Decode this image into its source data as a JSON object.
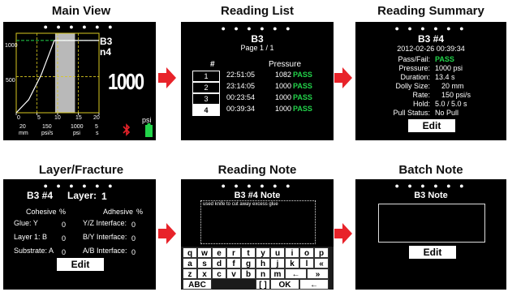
{
  "titles": {
    "main_view": "Main View",
    "reading_list": "Reading List",
    "reading_summary": "Reading Summary",
    "layer_fracture": "Layer/Fracture",
    "reading_note": "Reading Note",
    "batch_note": "Batch Note"
  },
  "dots": "● ● ● ● ● ●",
  "main_view": {
    "y_ticks": [
      "1000",
      "500"
    ],
    "x_ticks": [
      "0",
      "5",
      "10",
      "15",
      "20"
    ],
    "x_unit": "psi",
    "batch": "B3",
    "reading": "n4",
    "big_value": "1000",
    "bottom_values": [
      "20",
      "150",
      "1000",
      "5"
    ],
    "bottom_units": [
      "mm",
      "psi/s",
      "psi",
      "s"
    ],
    "curve_points": [
      [
        0,
        0
      ],
      [
        3,
        180
      ],
      [
        6,
        520
      ],
      [
        8,
        820
      ],
      [
        9.2,
        1000
      ],
      [
        20,
        1000
      ]
    ],
    "x_range": [
      0,
      20
    ],
    "y_range": [
      0,
      1100
    ]
  },
  "reading_list": {
    "batch": "B3",
    "page": "Page 1 / 1",
    "col_num": "#",
    "col_pressure": "Pressure",
    "rows": [
      {
        "num": "1",
        "time": "22:51:05",
        "pressure": "1082",
        "status": "PASS"
      },
      {
        "num": "2",
        "time": "23:14:05",
        "pressure": "1000",
        "status": "PASS"
      },
      {
        "num": "3",
        "time": "00:23:54",
        "pressure": "1000",
        "status": "PASS"
      },
      {
        "num": "4",
        "time": "00:39:34",
        "pressure": "1000",
        "status": "PASS"
      }
    ]
  },
  "reading_summary": {
    "title": "B3 #4",
    "datetime": "2012-02-26 00:39:34",
    "rows": [
      {
        "label": "Pass/Fail:",
        "value": "PASS"
      },
      {
        "label": "Pressure:",
        "value": "1000 psi"
      },
      {
        "label": "Duration:",
        "value": "13.4 s"
      },
      {
        "label": "Dolly Size:",
        "value": "20 mm"
      },
      {
        "label": "Rate:",
        "value": "150 psi/s"
      },
      {
        "label": "Hold:",
        "value": "5.0 / 5.0 s"
      },
      {
        "label": "Pull Status:",
        "value": "No Pull"
      }
    ],
    "edit": "Edit"
  },
  "layer_fracture": {
    "title": "B3 #4",
    "layer_label": "Layer:",
    "layer_value": "1",
    "cohesive": "Cohesive",
    "adhesive": "Adhesive",
    "pct": "%",
    "rows": [
      {
        "left": "Glue: Y",
        "left_val": "0",
        "right": "Y/Z Interface:",
        "right_val": "0"
      },
      {
        "left": "Layer 1: B",
        "left_val": "0",
        "right": "B/Y Interface:",
        "right_val": "0"
      },
      {
        "left": "Substrate: A",
        "left_val": "0",
        "right": "A/B Interface:",
        "right_val": "0"
      }
    ],
    "edit": "Edit"
  },
  "reading_note": {
    "title": "B3 #4 Note",
    "note": "used knife to cut away excess glue",
    "keyboard_rows": [
      [
        "q",
        "w",
        "e",
        "r",
        "t",
        "y",
        "u",
        "i",
        "o",
        "p"
      ],
      [
        "a",
        "s",
        "d",
        "f",
        "g",
        "h",
        "j",
        "k",
        "l",
        "«"
      ],
      [
        "z",
        "x",
        "c",
        "v",
        "b",
        "n",
        "m",
        "←",
        "»"
      ]
    ],
    "bottom_keys": [
      "ABC",
      "[ ]",
      "OK",
      "←"
    ]
  },
  "batch_note": {
    "title": "B3 Note",
    "edit": "Edit"
  },
  "colors": {
    "accent_red": "#e8232a",
    "pass_green": "#22d44a",
    "grid_yellow": "#d8c820"
  }
}
